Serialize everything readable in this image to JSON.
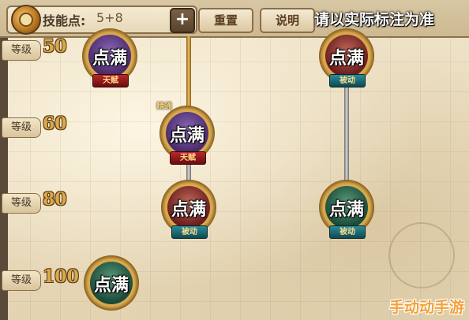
{
  "topbar": {
    "skill_points_label": "技能点:",
    "skill_points_value": "5+8",
    "plus_label": "+",
    "reset_label": "重置",
    "help_label": "说明"
  },
  "overlay_note": "请以实际标注为准",
  "levels": [
    {
      "label": "等级",
      "value": "50"
    },
    {
      "label": "等级",
      "value": "60"
    },
    {
      "label": "等级",
      "value": "80"
    },
    {
      "label": "等级",
      "value": "100"
    }
  ],
  "nodes": [
    {
      "text": "点满",
      "tag": "天赋",
      "color": "purple"
    },
    {
      "text": "点满",
      "tag": "被动",
      "color": "red"
    },
    {
      "text": "点满",
      "tag": "天赋",
      "color": "purple",
      "badge": "精通"
    },
    {
      "text": "点满",
      "tag": "被动",
      "color": "red"
    },
    {
      "text": "点满",
      "tag": "被动",
      "color": "green"
    },
    {
      "text": "点满",
      "tag": "",
      "color": "green"
    }
  ],
  "watermark": "手动动手游",
  "colors": {
    "level_number": "#d9a94a",
    "talent_tag": "#b8282a",
    "passive_tag": "#2a8c9a",
    "watermark": "#f2a23a"
  }
}
